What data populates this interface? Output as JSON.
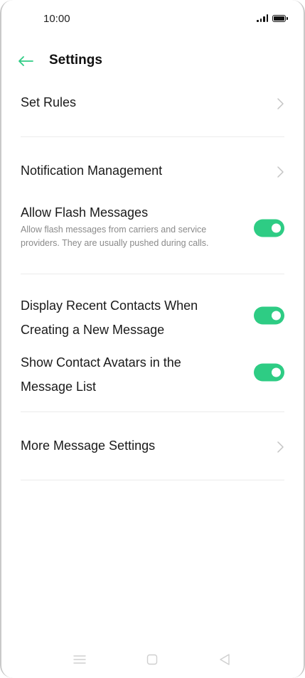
{
  "status_bar": {
    "time": "10:00"
  },
  "header": {
    "title": "Settings",
    "back_icon": "arrow-left-icon"
  },
  "colors": {
    "accent": "#2ecc84",
    "divider": "#ebebeb",
    "secondary_text": "#8a8a8a"
  },
  "settings": {
    "set_rules": {
      "label": "Set Rules"
    },
    "notification_management": {
      "label": "Notification Management"
    },
    "allow_flash_messages": {
      "label": "Allow Flash Messages",
      "description": "Allow flash messages from carriers and service providers. They are usually pushed during calls.",
      "enabled": true
    },
    "display_recent_contacts": {
      "label_line1": "Display Recent Contacts When",
      "label_line2": "Creating a New Message",
      "enabled": true
    },
    "show_contact_avatars": {
      "label_line1": "Show Contact Avatars in the",
      "label_line2": "Message List",
      "enabled": true
    },
    "more_message_settings": {
      "label": "More Message Settings"
    }
  },
  "nav_bar": {
    "menu_icon": "menu-icon",
    "home_icon": "square-home-icon",
    "back_icon": "triangle-back-icon"
  }
}
